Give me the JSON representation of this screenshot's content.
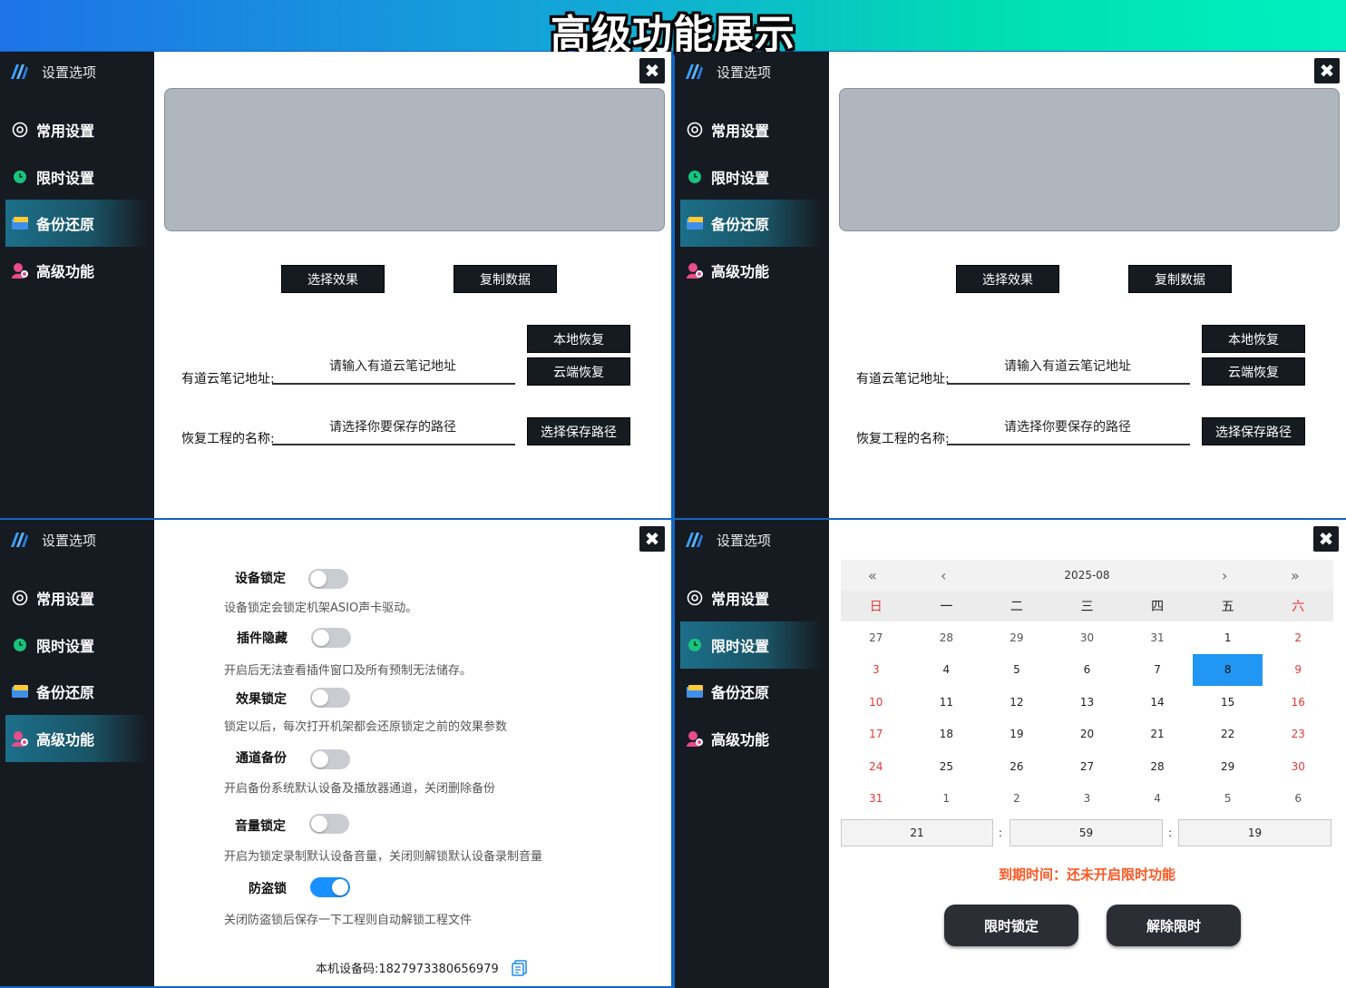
{
  "banner": {
    "title": "高级功能展示"
  },
  "sidebar": {
    "header": "设置选项",
    "items": [
      {
        "label": "常用设置",
        "icon": "settings-circle-icon"
      },
      {
        "label": "限时设置",
        "icon": "clock-icon"
      },
      {
        "label": "备份还原",
        "icon": "backup-icon"
      },
      {
        "label": "高级功能",
        "icon": "advanced-user-icon"
      }
    ]
  },
  "close": {
    "label": "✖"
  },
  "backup": {
    "select_effect": "选择效果",
    "copy_data": "复制数据",
    "local_restore": "本地恢复",
    "cloud_restore": "云端恢复",
    "youdao_label": "有道云笔记地址:",
    "youdao_placeholder": "请输入有道云笔记地址",
    "project_label": "恢复工程的名称:",
    "project_placeholder": "请选择你要保存的路径",
    "select_path": "选择保存路径"
  },
  "advanced": {
    "options": [
      {
        "title": "设备锁定",
        "desc": "设备锁定会锁定机架ASIO声卡驱动。",
        "on": false
      },
      {
        "title": "插件隐藏",
        "desc": "开启后无法查看插件窗口及所有预制无法储存。",
        "on": false
      },
      {
        "title": "效果锁定",
        "desc": "锁定以后，每次打开机架都会还原锁定之前的效果参数",
        "on": false
      },
      {
        "title": "通道备份",
        "desc": "开启备份系统默认设备及播放器通道，关闭删除备份",
        "on": false
      },
      {
        "title": "音量锁定",
        "desc": "开启为锁定录制默认设备音量，关闭则解锁默认设备录制音量",
        "on": false
      },
      {
        "title": "防盗锁",
        "desc": "关闭防盗锁后保存一下工程则自动解锁工程文件",
        "on": true
      }
    ],
    "device_code": "本机设备码:1827973380656979"
  },
  "timer": {
    "nav": {
      "prev_year": "«",
      "prev_month": "‹",
      "next_month": "›",
      "next_year": "»"
    },
    "month": "2025-08",
    "weekdays": [
      "日",
      "一",
      "二",
      "三",
      "四",
      "五",
      "六"
    ],
    "days": [
      [
        "27",
        "28",
        "29",
        "30",
        "31",
        "1",
        "2"
      ],
      [
        "3",
        "4",
        "5",
        "6",
        "7",
        "8",
        "9"
      ],
      [
        "10",
        "11",
        "12",
        "13",
        "14",
        "15",
        "16"
      ],
      [
        "17",
        "18",
        "19",
        "20",
        "21",
        "22",
        "23"
      ],
      [
        "24",
        "25",
        "26",
        "27",
        "28",
        "29",
        "30"
      ],
      [
        "31",
        "1",
        "2",
        "3",
        "4",
        "5",
        "6"
      ]
    ],
    "selected_day": "8",
    "time": {
      "hour": "21",
      "minute": "59",
      "second": "19",
      "sep": ":"
    },
    "expire_text": "到期时间：还未开启限时功能",
    "lock_button": "限时锁定",
    "unlock_button": "解除限时"
  },
  "colors": {
    "sidebar": "#161b22",
    "accent": "#1890ff",
    "warning": "#ff5722",
    "weekend": "#e53935"
  }
}
